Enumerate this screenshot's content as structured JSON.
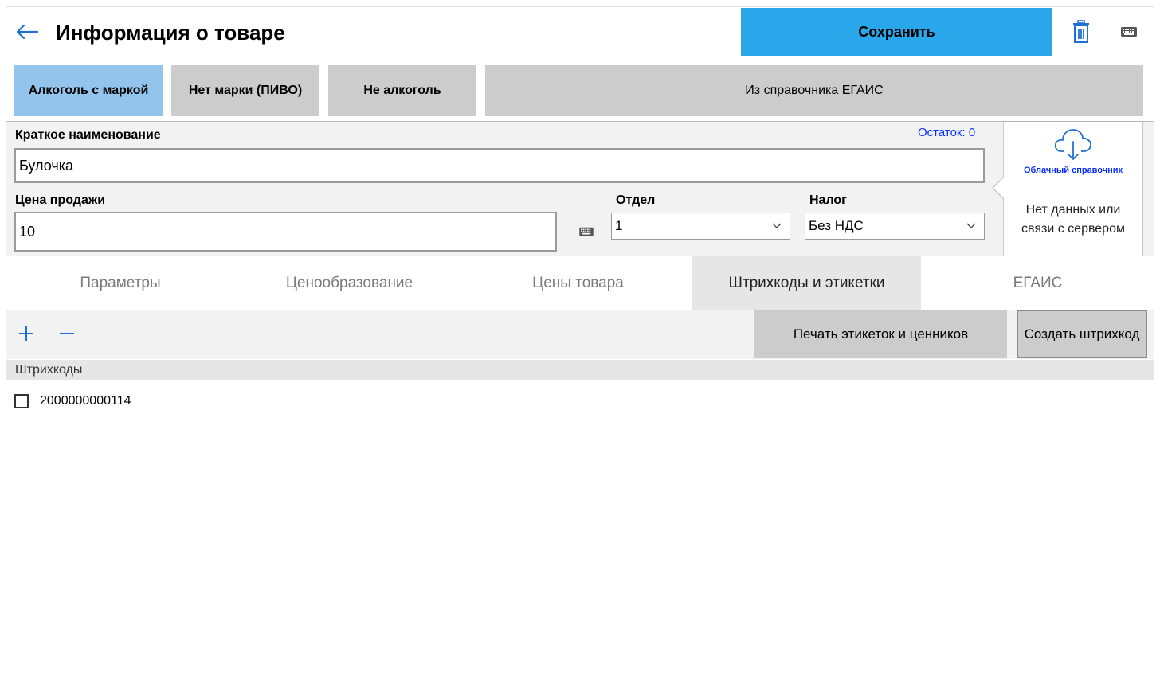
{
  "header": {
    "title": "Информация о товаре",
    "save_label": "Сохранить",
    "icons": [
      "back-arrow-icon",
      "trash-icon",
      "keyboard-icon"
    ]
  },
  "product_type": {
    "options": [
      "Алкоголь с маркой",
      "Нет марки (ПИВО)",
      "Не алкоголь"
    ],
    "selected": "Алкоголь с маркой",
    "egais_button": "Из справочника ЕГАИС"
  },
  "form": {
    "short_name_label": "Краткое наименование",
    "short_name_value": "Булочка",
    "stock_label": "Остаток: 0",
    "price_label": "Цена продажи",
    "price_value": "10",
    "department_label": "Отдел",
    "department_value": "1",
    "tax_label": "Налог",
    "tax_value": "Без НДС"
  },
  "cloud": {
    "title": "Облачный справочник",
    "status": "Нет данных или связи с сервером"
  },
  "tabs": [
    {
      "label": "Параметры",
      "active": false
    },
    {
      "label": "Ценообразование",
      "active": false
    },
    {
      "label": "Цены товара",
      "active": false
    },
    {
      "label": "Штрихкоды и этикетки",
      "active": true
    },
    {
      "label": "ЕГАИС",
      "active": false
    }
  ],
  "toolbar": {
    "print_label": "Печать этикеток и ценников",
    "create_barcode_label": "Создать штрихкод"
  },
  "barcodes": {
    "header": "Штрихкоды",
    "items": [
      {
        "code": "2000000000114",
        "checked": false
      }
    ]
  },
  "colors": {
    "accent": "#2aa7ea",
    "selected_type": "#93c5ec",
    "link": "#0a2fff"
  }
}
